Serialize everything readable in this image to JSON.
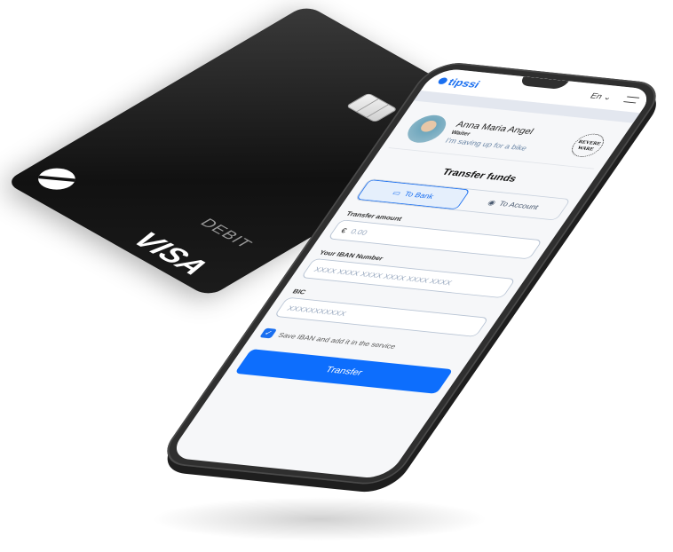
{
  "card": {
    "type": "DEBIT",
    "brand": "VISA"
  },
  "app": {
    "logo": "tipssi",
    "language": "En"
  },
  "profile": {
    "name": "Anna Maria Angel",
    "role": "Waiter",
    "note": "I'm saving up for a bike",
    "badge": "REVERE WARE"
  },
  "transfer": {
    "title": "Transfer funds",
    "tabs": [
      {
        "label": "To Bank",
        "active": true
      },
      {
        "label": "To Account",
        "active": false
      }
    ],
    "amount_label": "Transfer amount",
    "currency": "€",
    "amount_placeholder": "0.00",
    "iban_label": "Your IBAN Number",
    "iban_placeholder": "XXXX XXXX XXXX XXXX XXXX XXXX",
    "bic_label": "BIC",
    "bic_placeholder": "XXXXXXXXXXX",
    "save_label": "Save IBAN and add it in the service",
    "save_checked": true,
    "button": "Transfer"
  },
  "colors": {
    "accent": "#0d6efd"
  }
}
